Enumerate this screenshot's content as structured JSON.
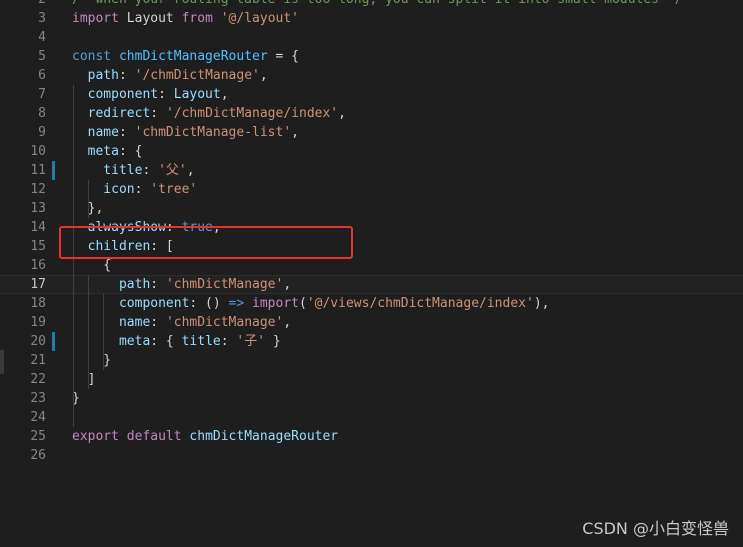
{
  "editor": {
    "lines": [
      {
        "num": "2",
        "tokens": [
          {
            "t": "/* when your routing table is too long, you can split it into small modules */",
            "c": "c"
          }
        ]
      },
      {
        "num": "3",
        "tokens": [
          {
            "t": "import",
            "c": "kw"
          },
          {
            "t": " Layout ",
            "c": "d"
          },
          {
            "t": "from",
            "c": "kw"
          },
          {
            "t": " ",
            "c": "d"
          },
          {
            "t": "'@/layout'",
            "c": "s"
          }
        ]
      },
      {
        "num": "4",
        "tokens": []
      },
      {
        "num": "5",
        "tokens": [
          {
            "t": "const",
            "c": "k"
          },
          {
            "t": " ",
            "c": "d"
          },
          {
            "t": "chmDictManageRouter",
            "c": "cv"
          },
          {
            "t": " = {",
            "c": "d"
          }
        ]
      },
      {
        "num": "6",
        "tokens": [
          {
            "t": "  path",
            "c": "v"
          },
          {
            "t": ": ",
            "c": "d"
          },
          {
            "t": "'/chmDictManage'",
            "c": "s"
          },
          {
            "t": ",",
            "c": "d"
          }
        ]
      },
      {
        "num": "7",
        "tokens": [
          {
            "t": "  component",
            "c": "v"
          },
          {
            "t": ": ",
            "c": "d"
          },
          {
            "t": "Layout",
            "c": "v"
          },
          {
            "t": ",",
            "c": "d"
          }
        ]
      },
      {
        "num": "8",
        "tokens": [
          {
            "t": "  redirect",
            "c": "v"
          },
          {
            "t": ": ",
            "c": "d"
          },
          {
            "t": "'/chmDictManage/index'",
            "c": "s"
          },
          {
            "t": ",",
            "c": "d"
          }
        ]
      },
      {
        "num": "9",
        "tokens": [
          {
            "t": "  name",
            "c": "v"
          },
          {
            "t": ": ",
            "c": "d"
          },
          {
            "t": "'chmDictManage-list'",
            "c": "s"
          },
          {
            "t": ",",
            "c": "d"
          }
        ]
      },
      {
        "num": "10",
        "tokens": [
          {
            "t": "  meta",
            "c": "v"
          },
          {
            "t": ": {",
            "c": "d"
          }
        ]
      },
      {
        "num": "11",
        "tokens": [
          {
            "t": "    title",
            "c": "v"
          },
          {
            "t": ": ",
            "c": "d"
          },
          {
            "t": "'父'",
            "c": "s"
          },
          {
            "t": ",",
            "c": "d"
          }
        ]
      },
      {
        "num": "12",
        "tokens": [
          {
            "t": "    icon",
            "c": "v"
          },
          {
            "t": ": ",
            "c": "d"
          },
          {
            "t": "'tree'",
            "c": "s"
          }
        ]
      },
      {
        "num": "13",
        "tokens": [
          {
            "t": "  },",
            "c": "d"
          }
        ]
      },
      {
        "num": "14",
        "tokens": [
          {
            "t": "  alwaysShow",
            "c": "v"
          },
          {
            "t": ": ",
            "c": "d"
          },
          {
            "t": "true",
            "c": "k"
          },
          {
            "t": ",",
            "c": "d"
          }
        ]
      },
      {
        "num": "15",
        "tokens": [
          {
            "t": "  children",
            "c": "v"
          },
          {
            "t": ": [",
            "c": "d"
          }
        ]
      },
      {
        "num": "16",
        "tokens": [
          {
            "t": "    {",
            "c": "d"
          }
        ]
      },
      {
        "num": "17",
        "tokens": [
          {
            "t": "      path",
            "c": "v"
          },
          {
            "t": ": ",
            "c": "d"
          },
          {
            "t": "'chmDictManage'",
            "c": "s"
          },
          {
            "t": ",",
            "c": "d"
          }
        ]
      },
      {
        "num": "18",
        "tokens": [
          {
            "t": "      component",
            "c": "v"
          },
          {
            "t": ": () ",
            "c": "d"
          },
          {
            "t": "=>",
            "c": "k"
          },
          {
            "t": " ",
            "c": "d"
          },
          {
            "t": "import",
            "c": "kw"
          },
          {
            "t": "(",
            "c": "d"
          },
          {
            "t": "'@/views/chmDictManage/index'",
            "c": "s"
          },
          {
            "t": "),",
            "c": "d"
          }
        ]
      },
      {
        "num": "19",
        "tokens": [
          {
            "t": "      name",
            "c": "v"
          },
          {
            "t": ": ",
            "c": "d"
          },
          {
            "t": "'chmDictManage'",
            "c": "s"
          },
          {
            "t": ",",
            "c": "d"
          }
        ]
      },
      {
        "num": "20",
        "tokens": [
          {
            "t": "      meta",
            "c": "v"
          },
          {
            "t": ": { ",
            "c": "d"
          },
          {
            "t": "title",
            "c": "v"
          },
          {
            "t": ": ",
            "c": "d"
          },
          {
            "t": "'子'",
            "c": "s"
          },
          {
            "t": " }",
            "c": "d"
          }
        ]
      },
      {
        "num": "21",
        "tokens": [
          {
            "t": "    }",
            "c": "d"
          }
        ]
      },
      {
        "num": "22",
        "tokens": [
          {
            "t": "  ]",
            "c": "d"
          }
        ]
      },
      {
        "num": "23",
        "tokens": [
          {
            "t": "}",
            "c": "d"
          }
        ]
      },
      {
        "num": "24",
        "tokens": []
      },
      {
        "num": "25",
        "tokens": [
          {
            "t": "export",
            "c": "kw"
          },
          {
            "t": " ",
            "c": "d"
          },
          {
            "t": "default",
            "c": "kw"
          },
          {
            "t": " ",
            "c": "d"
          },
          {
            "t": "chmDictManageRouter",
            "c": "v"
          }
        ]
      },
      {
        "num": "26",
        "tokens": []
      }
    ],
    "current_line": "17",
    "modified_lines": [
      "11",
      "20"
    ]
  },
  "watermark": "CSDN @小白变怪兽",
  "colors": {
    "background": "#1e1e1e",
    "highlight_border": "#e8322e"
  }
}
